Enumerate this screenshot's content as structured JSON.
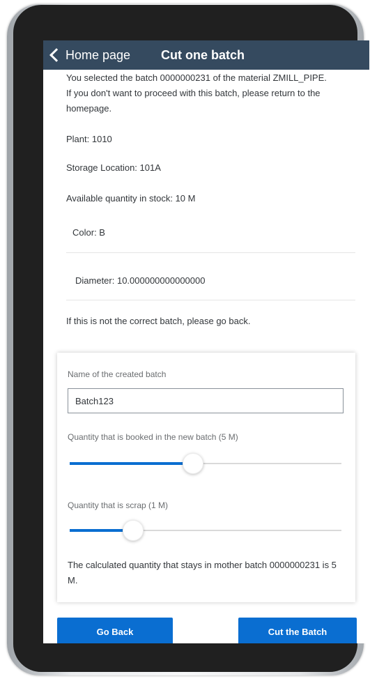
{
  "header": {
    "back_label": "Home page",
    "title": "Cut one batch"
  },
  "intro_text": "You selected the batch 0000000231 of the material ZMILL_PIPE. If you don't want to proceed with this batch, please return to the homepage.",
  "plant": "Plant: 1010",
  "storage_location": "Storage Location: 101A",
  "available_quantity": "Available quantity in stock: 10 M",
  "color": "Color: B",
  "diameter": "Diameter: 10.000000000000000",
  "warning_text": "If this is not the correct batch, please go back.",
  "form": {
    "batch_name_label": "Name of the created batch",
    "batch_name_value": "Batch123",
    "booked_label": "Quantity that is booked in the new batch (5 M)",
    "booked_fraction": 0.45,
    "scrap_label": "Quantity that is scrap (1 M)",
    "scrap_fraction": 0.23,
    "remaining_text": "The calculated quantity that stays in mother batch 0000000231 is 5 M."
  },
  "buttons": {
    "go_back": "Go Back",
    "cut_batch": "Cut the Batch"
  },
  "colors": {
    "header_bg": "#354a5f",
    "accent": "#0a6ed1"
  }
}
